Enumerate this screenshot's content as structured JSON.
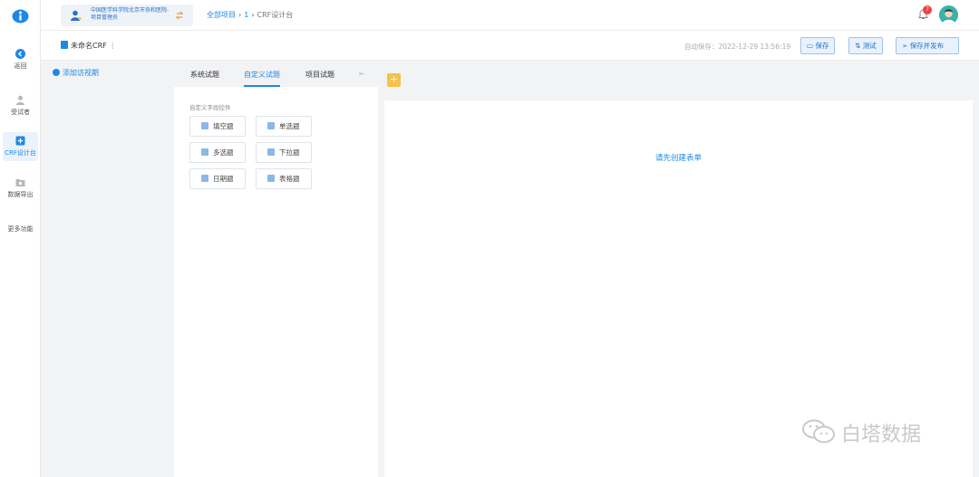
{
  "rail": {
    "items": [
      {
        "label": "返回"
      },
      {
        "label": "受试者"
      },
      {
        "label": "CRF设计台"
      },
      {
        "label": "数据导出"
      },
      {
        "label": "更多功能"
      }
    ]
  },
  "header": {
    "org_name": "中国医学科学院北京市协和医院-项目管理员",
    "breadcrumb": {
      "all": "全部项目",
      "sep": "›",
      "project": "1",
      "current": "CRF设计台"
    },
    "notification_count": "7"
  },
  "subbar": {
    "doc_title": "未命名CRF",
    "doc_more": "⋮",
    "autosave": "自动保存：2022-12-29 13:56:19",
    "save_label": "保存",
    "test_label": "测试",
    "publish_label": "保存并发布"
  },
  "visit": {
    "add_label": "添加访视期"
  },
  "library": {
    "tabs": [
      "系统试题",
      "自定义试题",
      "项目试题"
    ],
    "active_tab": "自定义试题",
    "caption": "自定义字段控件",
    "controls": [
      "填空题",
      "单选题",
      "多选题",
      "下拉题",
      "日期题",
      "表格题"
    ]
  },
  "canvas": {
    "empty_text": "请先创建表单"
  },
  "watermark": {
    "text": "白塔数据"
  },
  "colors": {
    "accent": "#1e88e5",
    "badge": "#f04040",
    "add_button": "#f6c24a"
  },
  "icons": [
    "logo-icon",
    "back-icon",
    "person-icon",
    "crf-design-icon",
    "folder-icon",
    "bell-icon",
    "save-icon",
    "test-icon",
    "send-icon",
    "plus-icon",
    "collapse-icon",
    "wechat-icon"
  ]
}
